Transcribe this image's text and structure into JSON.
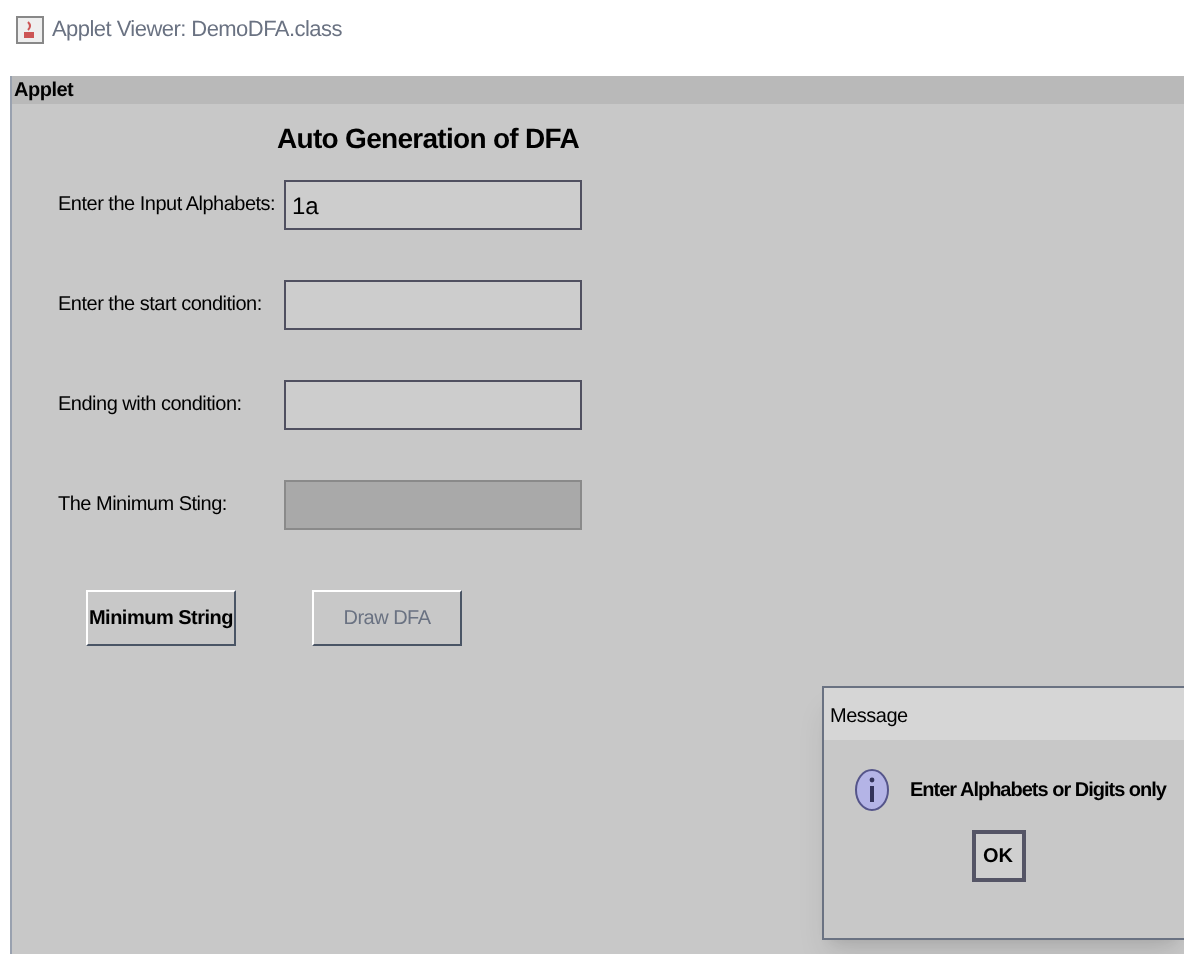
{
  "window": {
    "title": "Applet Viewer: DemoDFA.class"
  },
  "menu": [
    "Applet"
  ],
  "heading": "Auto Generation of DFA",
  "fields": [
    {
      "label": "Enter the Input Alphabets:",
      "value": "1a",
      "disabled": false
    },
    {
      "label": "Enter the start condition:",
      "disabled": false
    },
    {
      "label": "Ending with condition:",
      "disabled": false
    },
    {
      "label": "The Minimum Sting:",
      "disabled": true
    }
  ],
  "buttons": [
    {
      "label": "Minimum String",
      "disabled": false
    },
    {
      "label": "Draw DFA",
      "disabled": true
    }
  ],
  "dialog": {
    "title": "Message",
    "message": "Enter Alphabets or Digits only",
    "button": "OK"
  }
}
